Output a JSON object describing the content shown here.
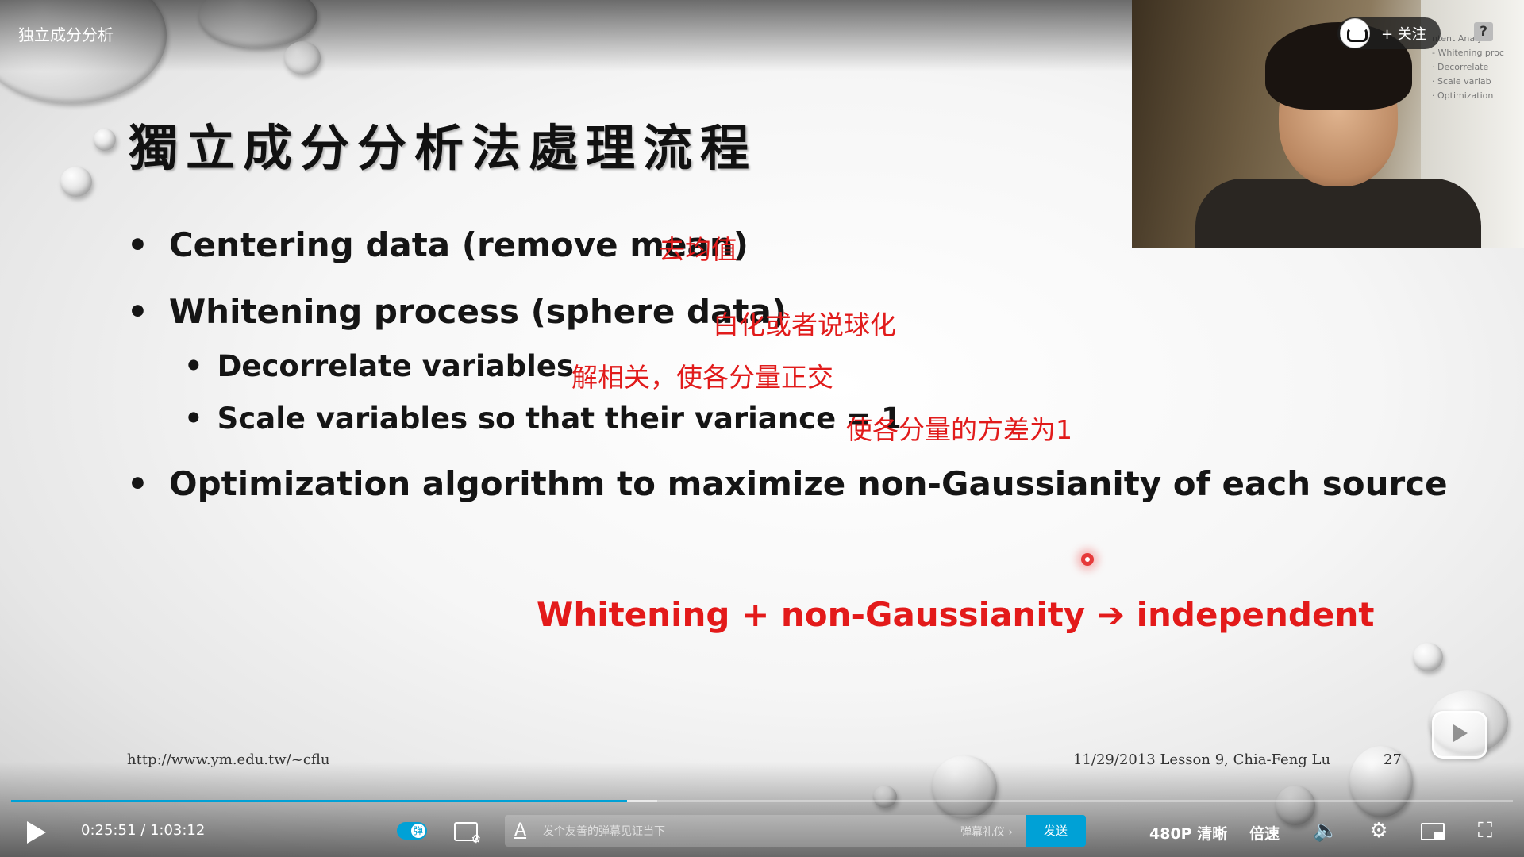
{
  "video": {
    "title": "独立成分分析"
  },
  "slide": {
    "heading": "獨立成分分析法處理流程",
    "bullets": [
      {
        "text": "Centering data (remove mean)",
        "annotation": "去均值"
      },
      {
        "text": "Whitening process (sphere data)",
        "annotation": "白化或者说球化"
      },
      {
        "text": "Decorrelate variables",
        "annotation": "解相关，使各分量正交"
      },
      {
        "text": "Scale variables so that their variance = 1",
        "annotation": "使各分量的方差为1"
      },
      {
        "text": "Optimization algorithm to maximize non-Gaussianity of each source"
      }
    ],
    "conclusion": "Whitening + non-Gaussianity ➔ independent",
    "footer_url": "http://www.ym.edu.tw/~cflu",
    "footer_date": "11/29/2013 Lesson 9, Chia-Feng Lu",
    "page_number": "27"
  },
  "webcam": {
    "follow_label": "+ 关注",
    "help_label": "?",
    "paper_lines": [
      "ntent Analys",
      "- Whitening proc",
      "· Decorrelate",
      "· Scale variab",
      "· Optimization"
    ]
  },
  "controls": {
    "current_time": "0:25:51",
    "separator": "/",
    "total_time": "1:03:12",
    "progress": 0.41,
    "buffered": 0.43,
    "danmaku_toggle_label": "弹",
    "danmaku_placeholder": "发个友善的弹幕见证当下",
    "danmaku_etiquette": "弹幕礼仪 ›",
    "send_label": "发送",
    "quality_label": "480P 清晰",
    "speed_label": "倍速",
    "accent_color": "#00a1d6"
  }
}
